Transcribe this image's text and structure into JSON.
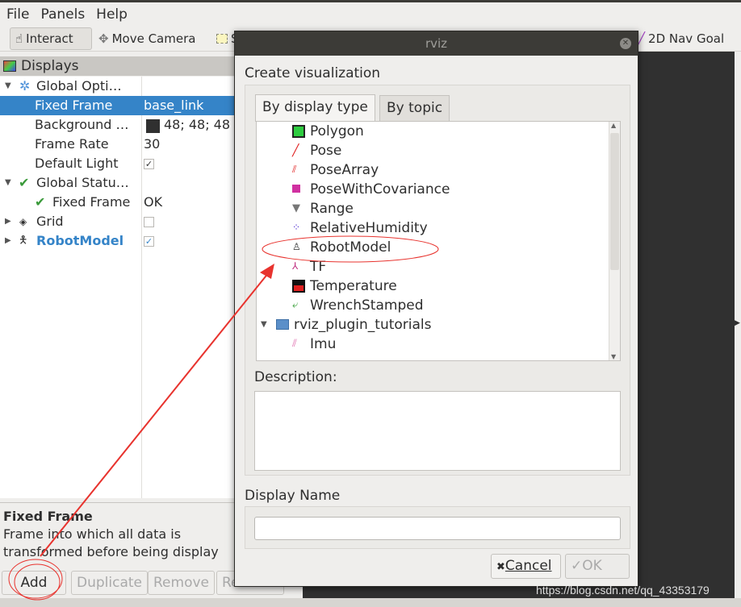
{
  "menu": [
    "File",
    "Panels",
    "Help"
  ],
  "toolbar": {
    "interact": "Interact",
    "move_camera": "Move Camera",
    "select": "S",
    "nav_goal": "2D Nav Goal"
  },
  "displays": {
    "title": "Displays",
    "rows": [
      {
        "key": "Global Opti…",
        "value": ""
      },
      {
        "key": "Fixed Frame",
        "value": "base_link"
      },
      {
        "key": "Background …",
        "value": "48; 48; 48"
      },
      {
        "key": "Frame Rate",
        "value": "30"
      },
      {
        "key": "Default Light",
        "value": "✓"
      },
      {
        "key": "Global Statu…",
        "value": ""
      },
      {
        "key": "Fixed Frame",
        "value": "OK"
      },
      {
        "key": "Grid",
        "value": ""
      },
      {
        "key": "RobotModel",
        "value": "✓"
      }
    ],
    "background_color": "#303030",
    "help_title": "Fixed Frame",
    "help_text": "Frame into which all data is transformed before being display",
    "buttons": [
      "Add",
      "Duplicate",
      "Remove",
      "Rename"
    ]
  },
  "dialog": {
    "title": "rviz",
    "heading": "Create visualization",
    "tabs": [
      "By display type",
      "By topic"
    ],
    "items": [
      "Polygon",
      "Pose",
      "PoseArray",
      "PoseWithCovariance",
      "Range",
      "RelativeHumidity",
      "RobotModel",
      "TF",
      "Temperature",
      "WrenchStamped"
    ],
    "folder": "rviz_plugin_tutorials",
    "folder_items": [
      "Imu"
    ],
    "description_label": "Description:",
    "display_name_label": "Display Name",
    "display_name_value": "",
    "cancel": "Cancel",
    "ok": "OK"
  },
  "watermark": "https://blog.csdn.net/qq_43353179",
  "colors": {
    "selection": "#3584c8",
    "annotation": "#e8332e",
    "link_blue": "#3584c8"
  }
}
